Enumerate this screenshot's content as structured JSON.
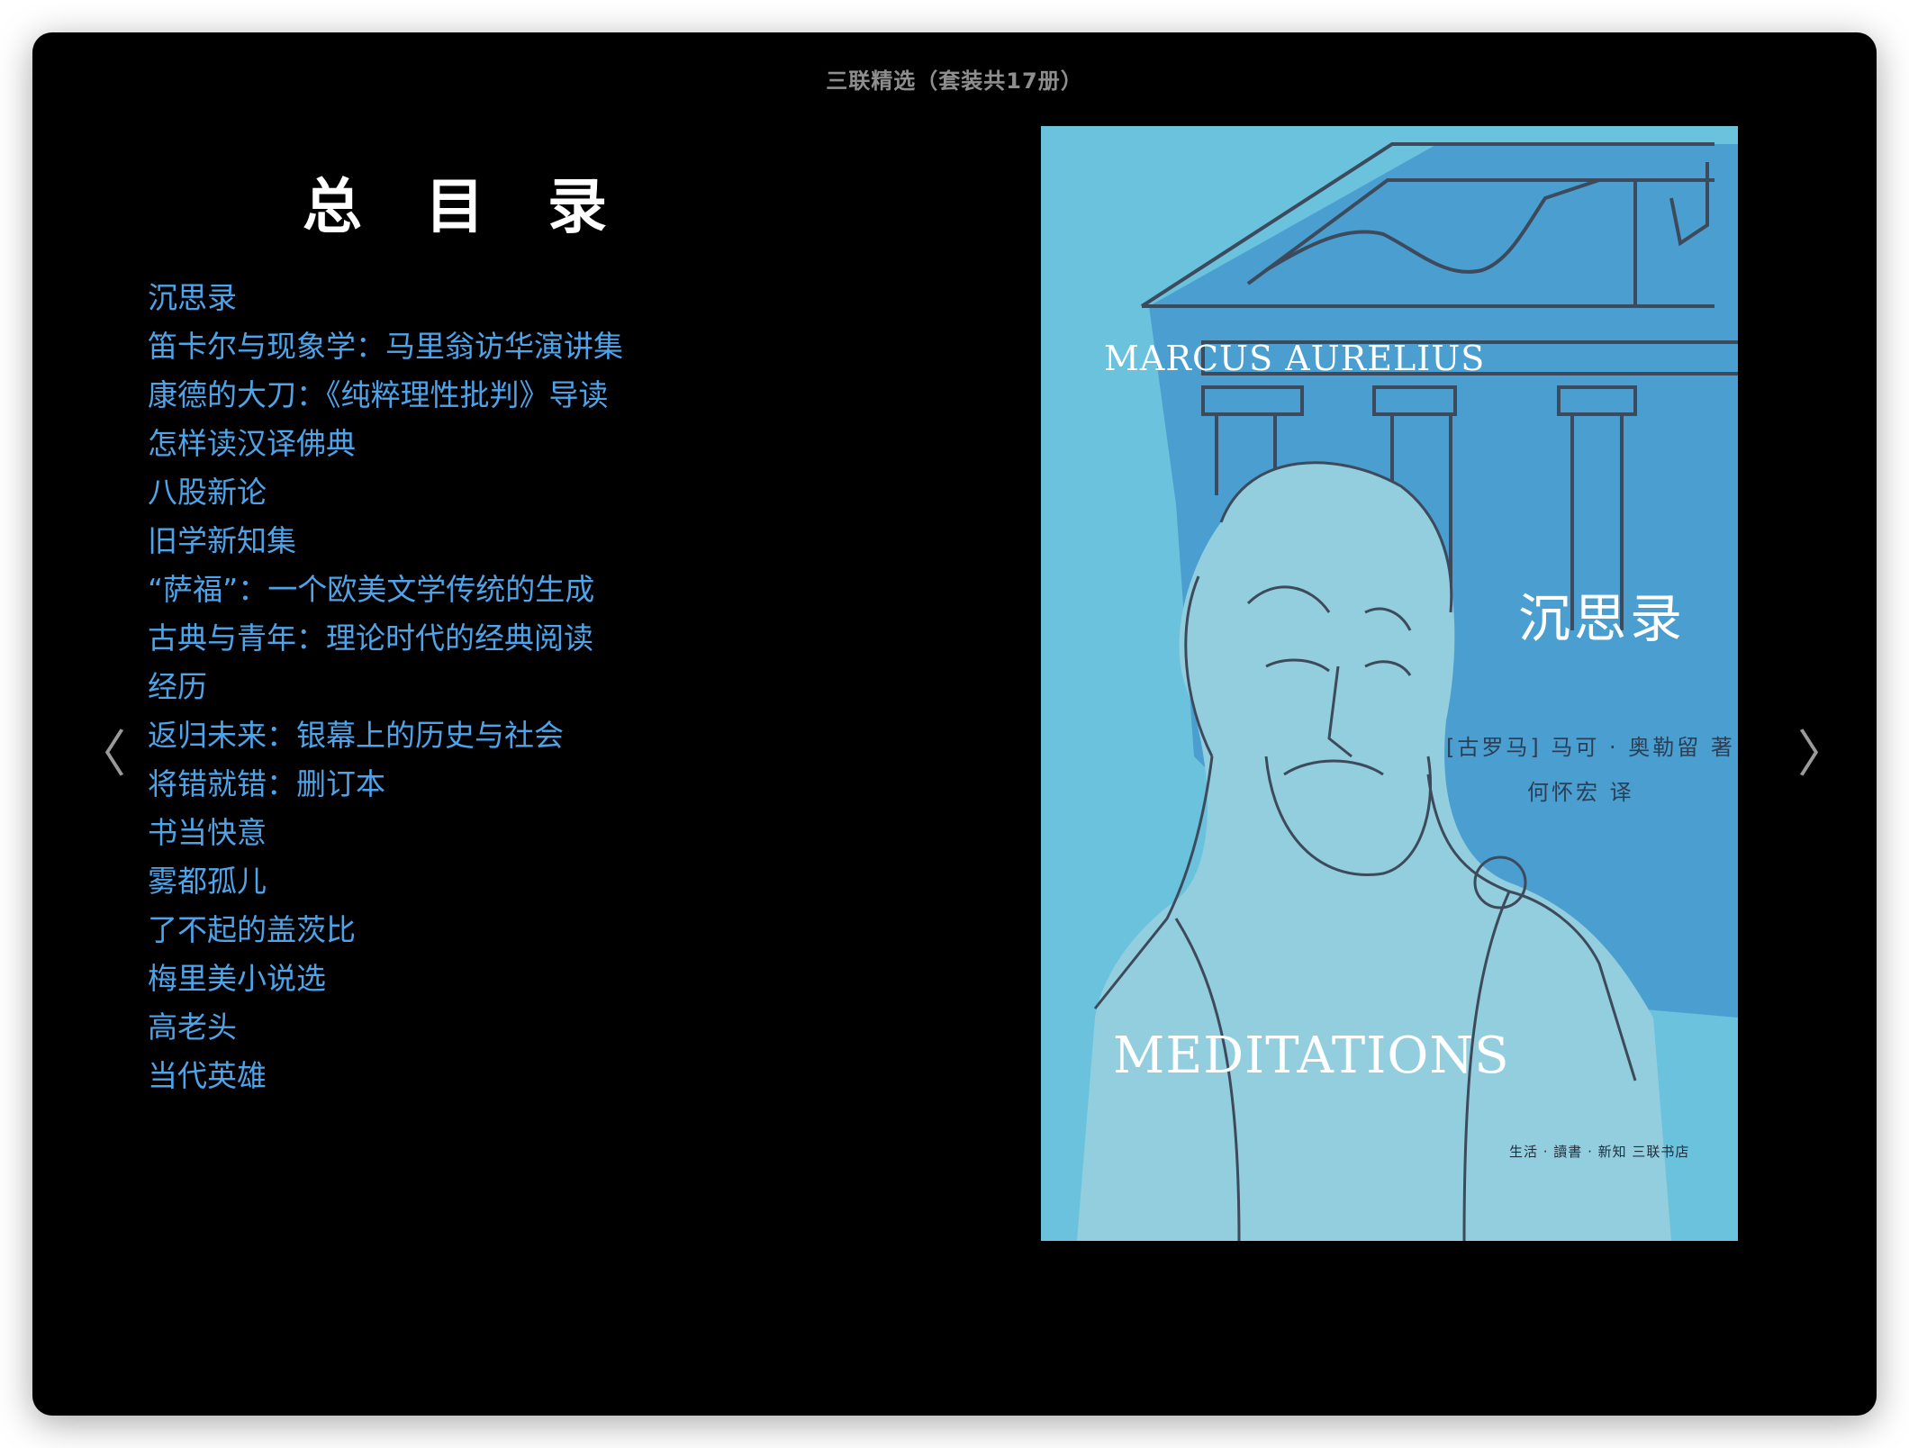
{
  "window": {
    "title": "三联精选（套装共17册）"
  },
  "toc": {
    "heading": "总目录",
    "items": [
      "沉思录",
      "笛卡尔与现象学：马里翁访华演讲集",
      "康德的大刀：《纯粹理性批判》导读",
      "怎样读汉译佛典",
      "八股新论",
      "旧学新知集",
      "“萨福”：一个欧美文学传统的生成",
      "古典与青年：理论时代的经典阅读",
      "经历",
      "返归未来：银幕上的历史与社会",
      "将错就错：删订本",
      "书当快意",
      "雾都孤儿",
      "了不起的盖茨比",
      "梅里美小说选",
      "高老头",
      "当代英雄"
    ],
    "link_color": "#4fa3e8"
  },
  "nav": {
    "prev_glyph": "〈",
    "next_glyph": "〉",
    "prev_icon": "chevron-left-icon",
    "next_icon": "chevron-right-icon"
  },
  "cover": {
    "author_en": "MARCUS AURELIUS",
    "title_cn": "沉思录",
    "author_cn": "[古罗马] 马可 · 奥勒留 著",
    "translator": "何怀宏 译",
    "title_en": "MEDITATIONS",
    "publisher": "生活 · 讀書 · 新知 三联书店",
    "colors": {
      "background": "#6ac2dd",
      "temple": "#4a9fd0",
      "bust": "#93cede",
      "line": "#3d4a5c"
    }
  }
}
